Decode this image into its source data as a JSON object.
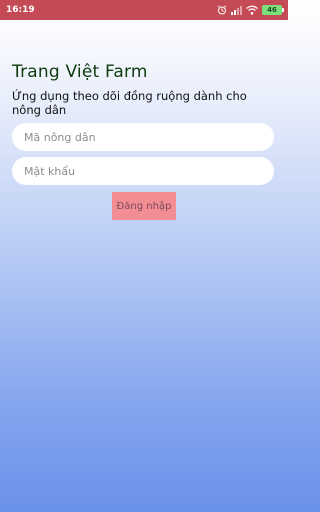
{
  "status_bar": {
    "time": "16:19",
    "battery": "46",
    "icons": [
      "alarm-icon",
      "cell-signal-icon",
      "wifi-icon",
      "battery-icon"
    ]
  },
  "app": {
    "title": "Trang Việt Farm",
    "subtitle": "Ứng dụng theo dõi đồng ruộng dành cho nông dân"
  },
  "form": {
    "farmer_code_placeholder": "Mã nông dân",
    "farmer_code_value": "",
    "password_placeholder": "Mật khẩu",
    "password_value": "",
    "login_label": "Đăng nhập"
  },
  "colors": {
    "status_bar": "#c44a55",
    "title": "#0e3a0e",
    "login_button": "#f28d94",
    "background_top": "#ffffff",
    "background_bottom": "#6a92ea"
  }
}
